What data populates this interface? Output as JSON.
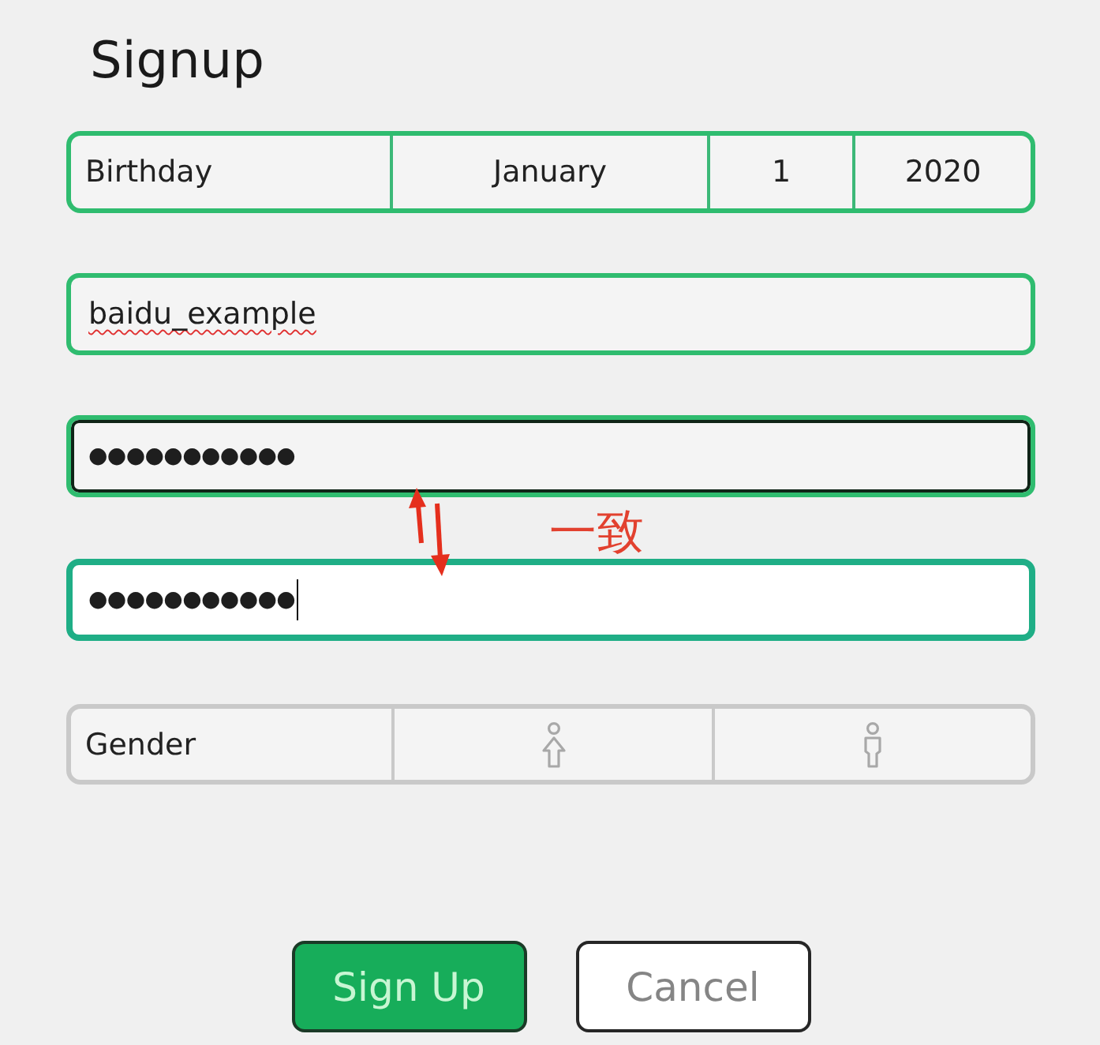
{
  "title": "Signup",
  "birthday": {
    "label": "Birthday",
    "month": "January",
    "day": "1",
    "year": "2020",
    "valid": true
  },
  "fields": [
    {
      "kind": "text",
      "value": "baidu_example",
      "spelling_error": true,
      "valid": true,
      "hovered": false,
      "focused": false
    },
    {
      "kind": "password",
      "value": "●●●●●●●●●●●",
      "valid": true,
      "hovered": true,
      "focused": false
    },
    {
      "kind": "password",
      "value": "●●●●●●●●●●●",
      "valid": true,
      "hovered": false,
      "focused": true
    }
  ],
  "annotation": {
    "text": "一致"
  },
  "gender": {
    "label": "Gender",
    "valid": false,
    "options": [
      {
        "kind": "female",
        "selected": false
      },
      {
        "kind": "male",
        "selected": false
      }
    ]
  },
  "buttons": [
    {
      "kind": "primary",
      "label": "Sign Up"
    },
    {
      "kind": "secondary",
      "label": "Cancel"
    }
  ]
}
